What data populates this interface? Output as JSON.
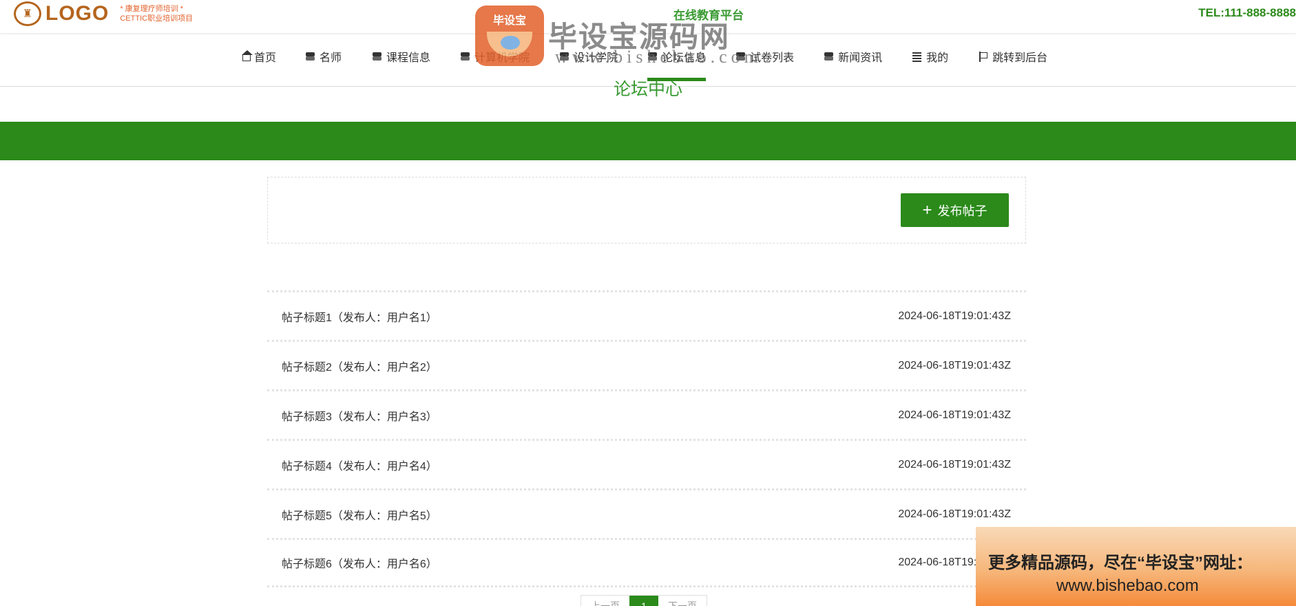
{
  "header": {
    "logo_mark": "LOGO",
    "logo_sub_line1": "* 康复理疗师培训 *",
    "logo_sub_line2": "CETTIC职业培训项目",
    "platform_title": "在线教育平台",
    "tel": "TEL:111-888-8888"
  },
  "nav": {
    "items": [
      {
        "label": "首页",
        "icon": "home-icon"
      },
      {
        "label": "名师",
        "icon": "layers-icon"
      },
      {
        "label": "课程信息",
        "icon": "layers-icon"
      },
      {
        "label": "计算机学院",
        "icon": "layers-icon"
      },
      {
        "label": "设计学院",
        "icon": "layers-icon"
      },
      {
        "label": "论坛信息",
        "icon": "layers-icon"
      },
      {
        "label": "试卷列表",
        "icon": "layers-icon"
      },
      {
        "label": "新闻资讯",
        "icon": "layers-icon"
      },
      {
        "label": "我的",
        "icon": "lines-icon"
      },
      {
        "label": "跳转到后台",
        "icon": "flag-icon"
      }
    ],
    "active_index": 5
  },
  "page": {
    "section_title": "论坛中心"
  },
  "actions": {
    "post_button_label": "发布帖子",
    "post_button_icon": "plus-icon"
  },
  "posts": [
    {
      "title": "帖子标题1（发布人：用户名1）",
      "time": "2024-06-18T19:01:43Z"
    },
    {
      "title": "帖子标题2（发布人：用户名2）",
      "time": "2024-06-18T19:01:43Z"
    },
    {
      "title": "帖子标题3（发布人：用户名3）",
      "time": "2024-06-18T19:01:43Z"
    },
    {
      "title": "帖子标题4（发布人：用户名4）",
      "time": "2024-06-18T19:01:43Z"
    },
    {
      "title": "帖子标题5（发布人：用户名5）",
      "time": "2024-06-18T19:01:43Z"
    },
    {
      "title": "帖子标题6（发布人：用户名6）",
      "time": "2024-06-18T19:01:43Z"
    }
  ],
  "pagination": {
    "prev_label": "上一页",
    "current_page": "1",
    "next_label": "下一页"
  },
  "watermark": {
    "badge_text": "毕设宝",
    "main_text": "毕设宝源码网",
    "url_text": "www.bishebao.com"
  },
  "promo": {
    "line1": "更多精品源码，尽在“毕设宝”网址：",
    "line2": "www.bishebao.com"
  },
  "colors": {
    "accent_green": "#2b8a1a",
    "title_green": "#3a9a33",
    "logo_brown": "#b5651d",
    "logo_orange": "#e2612b"
  }
}
